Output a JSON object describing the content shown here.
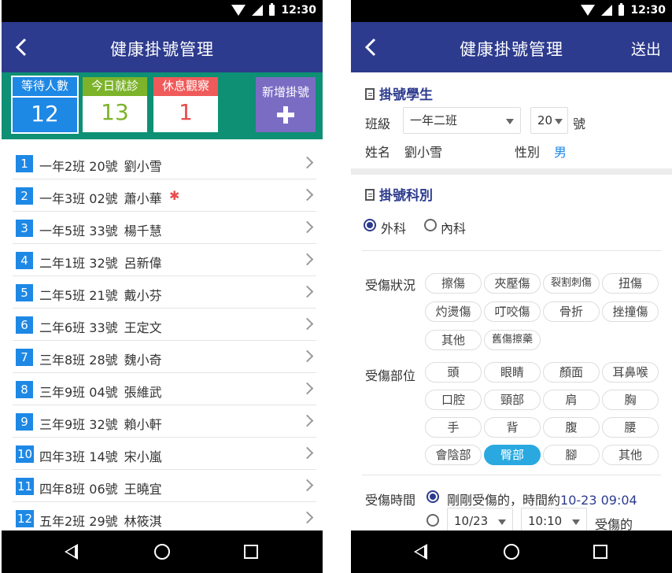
{
  "status_bar": {
    "time": "12:30"
  },
  "left": {
    "title": "健康掛號管理",
    "stats": {
      "waiting": {
        "label": "等待人數",
        "value": "12"
      },
      "today": {
        "label": "今日就診",
        "value": "13"
      },
      "rest": {
        "label": "休息觀察",
        "value": "1"
      },
      "new": {
        "label": "新增掛號"
      }
    },
    "rows": [
      {
        "idx": "1",
        "text": "一年2班 20號",
        "name": "劉小雪",
        "flag": ""
      },
      {
        "idx": "2",
        "text": "一年3班 02號",
        "name": "蕭小華",
        "flag": "✱"
      },
      {
        "idx": "3",
        "text": "一年5班 33號",
        "name": "楊千慧",
        "flag": ""
      },
      {
        "idx": "4",
        "text": "二年1班 32號",
        "name": "呂新偉",
        "flag": ""
      },
      {
        "idx": "5",
        "text": "二年5班 21號",
        "name": "戴小芬",
        "flag": ""
      },
      {
        "idx": "6",
        "text": "二年6班 33號",
        "name": "王定文",
        "flag": ""
      },
      {
        "idx": "7",
        "text": "三年8班 28號",
        "name": "魏小奇",
        "flag": ""
      },
      {
        "idx": "8",
        "text": "三年9班 04號",
        "name": "張維武",
        "flag": ""
      },
      {
        "idx": "9",
        "text": "三年9班 32號",
        "name": "賴小軒",
        "flag": ""
      },
      {
        "idx": "10",
        "text": "四年3班 14號",
        "name": "宋小嵐",
        "flag": ""
      },
      {
        "idx": "11",
        "text": "四年8班 06號",
        "name": "王曉宜",
        "flag": ""
      },
      {
        "idx": "12",
        "text": "五年2班 29號",
        "name": "林筱淇",
        "flag": ""
      }
    ]
  },
  "right": {
    "title": "健康掛號管理",
    "action": "送出",
    "student_section": "掛號學生",
    "class_label": "班級",
    "class_value": "一年二班",
    "seat_value": "20",
    "seat_suffix": "號",
    "name_label": "姓名",
    "name_value": "劉小雪",
    "gender_label": "性別",
    "gender_value": "男",
    "dept_section": "掛號科別",
    "dept_options": [
      "外科",
      "內科"
    ],
    "injury_label": "受傷狀況",
    "injury_chips": [
      "擦傷",
      "夾壓傷",
      "裂割刺傷",
      "扭傷",
      "灼燙傷",
      "叮咬傷",
      "骨折",
      "挫撞傷",
      "其他",
      "舊傷擦藥"
    ],
    "part_label": "受傷部位",
    "part_chips": [
      "頭",
      "眼睛",
      "顏面",
      "耳鼻喉",
      "口腔",
      "頸部",
      "肩",
      "胸",
      "手",
      "背",
      "腹",
      "腰",
      "會陰部",
      "臀部",
      "腳",
      "其他"
    ],
    "time_label": "受傷時間",
    "time_option1": "剛剛受傷的，時間約",
    "time_option1_value": "10-23 09:04",
    "time_date": "10/23",
    "time_clock": "10:10",
    "time_suffix": "受傷的"
  },
  "colors": {
    "appbar": "#2d3b8e",
    "stats_bg": "#0d9073",
    "waiting": "#1e88e5",
    "today": "#7cb32a",
    "rest": "#f05a5a",
    "new": "#7b6cc3",
    "chip_active": "#2aa9e0"
  }
}
